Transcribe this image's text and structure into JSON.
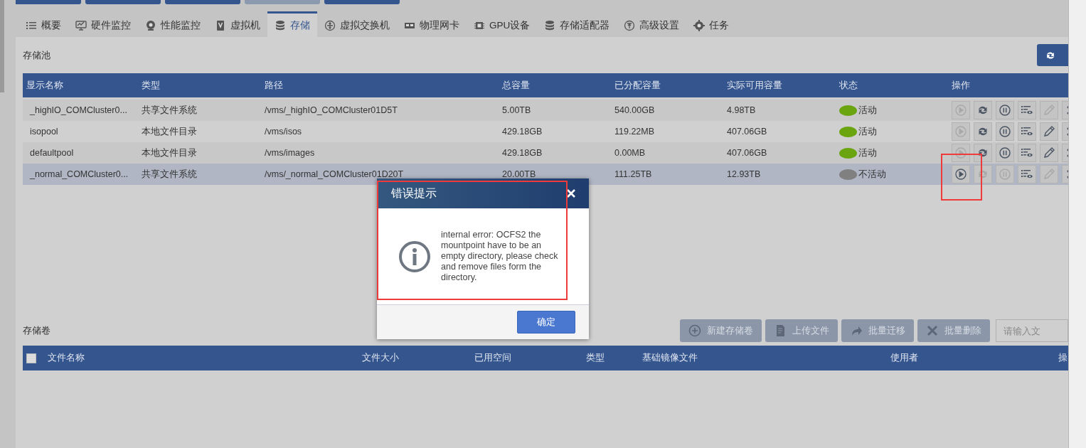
{
  "top_buttons": [
    {
      "selected": false
    },
    {
      "selected": false
    },
    {
      "selected": false
    },
    {
      "selected": true
    },
    {
      "selected": false
    }
  ],
  "tabs": [
    {
      "label": "概要",
      "selected": false
    },
    {
      "label": "硬件监控",
      "selected": false
    },
    {
      "label": "性能监控",
      "selected": false
    },
    {
      "label": "虚拟机",
      "selected": false
    },
    {
      "label": "存储",
      "selected": true
    },
    {
      "label": "虚拟交换机",
      "selected": false
    },
    {
      "label": "物理网卡",
      "selected": false
    },
    {
      "label": "GPU设备",
      "selected": false
    },
    {
      "label": "存储适配器",
      "selected": false
    },
    {
      "label": "高级设置",
      "selected": false
    },
    {
      "label": "任务",
      "selected": false
    }
  ],
  "pool_section": {
    "title": "存储池"
  },
  "pool_table": {
    "columns": [
      "显示名称",
      "类型",
      "路径",
      "总容量",
      "已分配容量",
      "实际可用容量",
      "状态",
      "操作"
    ],
    "rows": [
      {
        "name": "_highIO_COMCluster0...",
        "type": "共享文件系统",
        "path": "/vms/_highIO_COMCluster01D5T",
        "total": "5.00TB",
        "allocated": "540.00GB",
        "available": "4.98TB",
        "status": "活动",
        "color": "#6aa40f",
        "selected": false,
        "actions": [
          {
            "kind": "start",
            "disabled": true
          },
          {
            "kind": "sync",
            "disabled": false
          },
          {
            "kind": "pause",
            "disabled": false
          },
          {
            "kind": "view",
            "disabled": false
          },
          {
            "kind": "edit",
            "disabled": true
          },
          {
            "kind": "delete",
            "disabled": false
          }
        ]
      },
      {
        "name": "isopool",
        "type": "本地文件目录",
        "path": "/vms/isos",
        "total": "429.18GB",
        "allocated": "119.22MB",
        "available": "407.06GB",
        "status": "活动",
        "color": "#6aa40f",
        "selected": false,
        "actions": [
          {
            "kind": "start",
            "disabled": true
          },
          {
            "kind": "sync",
            "disabled": false
          },
          {
            "kind": "pause",
            "disabled": false
          },
          {
            "kind": "view",
            "disabled": false
          },
          {
            "kind": "edit",
            "disabled": false
          },
          {
            "kind": "delete",
            "disabled": false
          }
        ]
      },
      {
        "name": "defaultpool",
        "type": "本地文件目录",
        "path": "/vms/images",
        "total": "429.18GB",
        "allocated": "0.00MB",
        "available": "407.06GB",
        "status": "活动",
        "color": "#6aa40f",
        "selected": false,
        "actions": [
          {
            "kind": "start",
            "disabled": true
          },
          {
            "kind": "sync",
            "disabled": false
          },
          {
            "kind": "pause",
            "disabled": false
          },
          {
            "kind": "view",
            "disabled": false
          },
          {
            "kind": "edit",
            "disabled": false
          },
          {
            "kind": "delete",
            "disabled": false
          }
        ]
      },
      {
        "name": "_normal_COMCluster0...",
        "type": "共享文件系统",
        "path": "/vms/_normal_COMCluster01D20T",
        "total": "20.00TB",
        "allocated": "111.25TB",
        "available": "12.93TB",
        "status": "不活动",
        "color": "#808080",
        "selected": true,
        "actions": [
          {
            "kind": "start",
            "disabled": false
          },
          {
            "kind": "sync",
            "disabled": true
          },
          {
            "kind": "pause",
            "disabled": true
          },
          {
            "kind": "view",
            "disabled": false
          },
          {
            "kind": "edit",
            "disabled": true
          },
          {
            "kind": "delete",
            "disabled": false
          }
        ]
      }
    ]
  },
  "volume_section": {
    "title": "存储卷",
    "buttons": [
      {
        "label": "新建存储卷"
      },
      {
        "label": "上传文件"
      },
      {
        "label": "批量迁移"
      },
      {
        "label": "批量删除"
      }
    ],
    "search": {
      "placeholder": "请输入文"
    }
  },
  "volume_table": {
    "checked": false,
    "columns": [
      "文件名称",
      "文件大小",
      "已用空间",
      "类型",
      "基础镜像文件",
      "使用者",
      "操"
    ]
  },
  "dialog": {
    "title": "错误提示",
    "message": "internal error: OCFS2 the mountpoint have to be an empty directory, please check and remove files form the directory.",
    "confirm": "确定"
  }
}
